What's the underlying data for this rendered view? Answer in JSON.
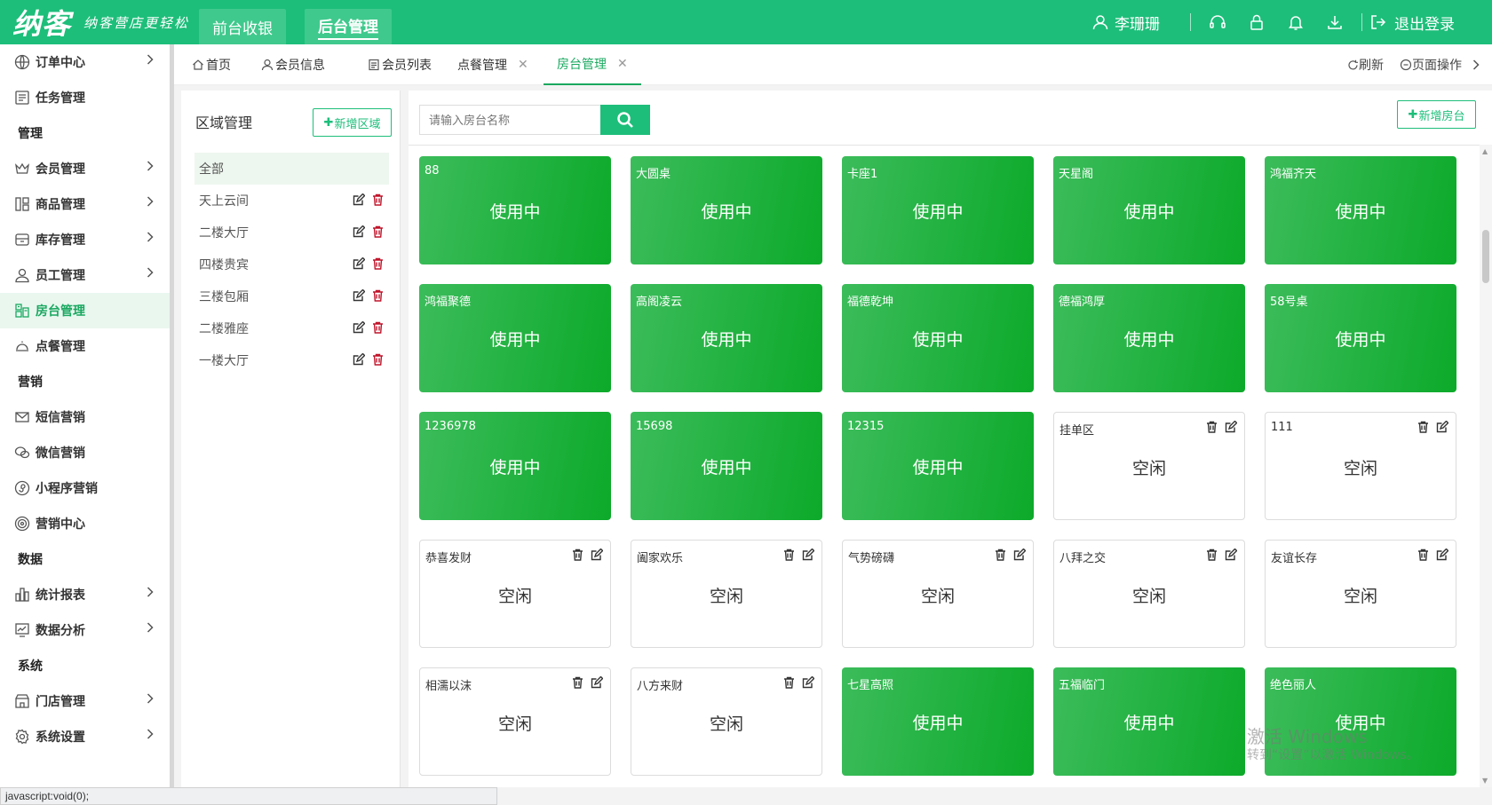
{
  "app": {
    "logo_text": "纳客",
    "slogan": "纳客营店更轻松",
    "module_tabs": [
      "前台收银",
      "后台管理"
    ],
    "active_module": "后台管理",
    "user_name": "李珊珊",
    "logout_label": "退出登录"
  },
  "sidebar": {
    "items": [
      {
        "type": "item",
        "label": "订单中心",
        "icon": "globe-icon",
        "chevron": true
      },
      {
        "type": "item",
        "label": "任务管理",
        "icon": "task-icon",
        "chevron": false
      },
      {
        "type": "group",
        "label": "管理"
      },
      {
        "type": "item",
        "label": "会员管理",
        "icon": "crown-icon",
        "chevron": true
      },
      {
        "type": "item",
        "label": "商品管理",
        "icon": "goods-icon",
        "chevron": true
      },
      {
        "type": "item",
        "label": "库存管理",
        "icon": "inventory-icon",
        "chevron": true
      },
      {
        "type": "item",
        "label": "员工管理",
        "icon": "user-icon",
        "chevron": true
      },
      {
        "type": "item",
        "label": "房台管理",
        "icon": "table-icon",
        "chevron": false,
        "active": true
      },
      {
        "type": "item",
        "label": "点餐管理",
        "icon": "dish-icon",
        "chevron": false
      },
      {
        "type": "group",
        "label": "营销"
      },
      {
        "type": "item",
        "label": "短信营销",
        "icon": "mail-icon",
        "chevron": false
      },
      {
        "type": "item",
        "label": "微信营销",
        "icon": "wechat-icon",
        "chevron": false
      },
      {
        "type": "item",
        "label": "小程序营销",
        "icon": "miniprogram-icon",
        "chevron": false
      },
      {
        "type": "item",
        "label": "营销中心",
        "icon": "target-icon",
        "chevron": false
      },
      {
        "type": "group",
        "label": "数据"
      },
      {
        "type": "item",
        "label": "统计报表",
        "icon": "bar-chart-icon",
        "chevron": true
      },
      {
        "type": "item",
        "label": "数据分析",
        "icon": "analysis-icon",
        "chevron": true
      },
      {
        "type": "group",
        "label": "系统"
      },
      {
        "type": "item",
        "label": "门店管理",
        "icon": "store-icon",
        "chevron": true
      },
      {
        "type": "item",
        "label": "系统设置",
        "icon": "gear-icon",
        "chevron": true
      }
    ]
  },
  "tabs": {
    "items": [
      {
        "label": "首页",
        "icon": "home-icon",
        "closable": false
      },
      {
        "label": "会员信息",
        "icon": "user-icon",
        "closable": false
      },
      {
        "label": "会员列表",
        "icon": "list-icon",
        "closable": false
      },
      {
        "label": "点餐管理",
        "icon": "",
        "closable": true
      },
      {
        "label": "房台管理",
        "icon": "",
        "closable": true,
        "active": true
      }
    ],
    "refresh_label": "刷新",
    "page_ops_label": "页面操作"
  },
  "area": {
    "title": "区域管理",
    "add_label": "新增区域",
    "items": [
      {
        "label": "全部",
        "selected": true,
        "editable": false
      },
      {
        "label": "天上云间",
        "editable": true
      },
      {
        "label": "二楼大厅",
        "editable": true
      },
      {
        "label": "四楼贵宾",
        "editable": true
      },
      {
        "label": "三楼包厢",
        "editable": true
      },
      {
        "label": "二楼雅座",
        "editable": true
      },
      {
        "label": "一楼大厅",
        "editable": true
      }
    ]
  },
  "rooms": {
    "search_placeholder": "请输入房台名称",
    "add_label": "新增房台",
    "status_busy": "使用中",
    "status_free": "空闲",
    "items": [
      {
        "name": "88",
        "status": "busy"
      },
      {
        "name": "大圆桌",
        "status": "busy"
      },
      {
        "name": "卡座1",
        "status": "busy"
      },
      {
        "name": "天星阁",
        "status": "busy"
      },
      {
        "name": "鸿福齐天",
        "status": "busy"
      },
      {
        "name": "鸿福聚德",
        "status": "busy"
      },
      {
        "name": "高阁凌云",
        "status": "busy"
      },
      {
        "name": "福德乾坤",
        "status": "busy"
      },
      {
        "name": "德福鸿厚",
        "status": "busy"
      },
      {
        "name": "58号桌",
        "status": "busy"
      },
      {
        "name": "1236978",
        "status": "busy"
      },
      {
        "name": "15698",
        "status": "busy"
      },
      {
        "name": "12315",
        "status": "busy"
      },
      {
        "name": "挂单区",
        "status": "free"
      },
      {
        "name": "111",
        "status": "free"
      },
      {
        "name": "恭喜发财",
        "status": "free"
      },
      {
        "name": "阖家欢乐",
        "status": "free"
      },
      {
        "name": "气势磅礴",
        "status": "free"
      },
      {
        "name": "八拜之交",
        "status": "free"
      },
      {
        "name": "友谊长存",
        "status": "free"
      },
      {
        "name": "相濡以沫",
        "status": "free"
      },
      {
        "name": "八方来财",
        "status": "free"
      },
      {
        "name": "七星高照",
        "status": "busy"
      },
      {
        "name": "五福临门",
        "status": "busy"
      },
      {
        "name": "绝色丽人",
        "status": "busy"
      }
    ]
  },
  "watermark": {
    "line1": "激活 Windows",
    "line2": "转到“设置”以激活 Windows。"
  },
  "statusbar": {
    "text": "javascript:void(0);"
  },
  "colors": {
    "brand": "#1dbe7a",
    "busy_card": "#0caa2a",
    "active_text": "#1aa860"
  }
}
